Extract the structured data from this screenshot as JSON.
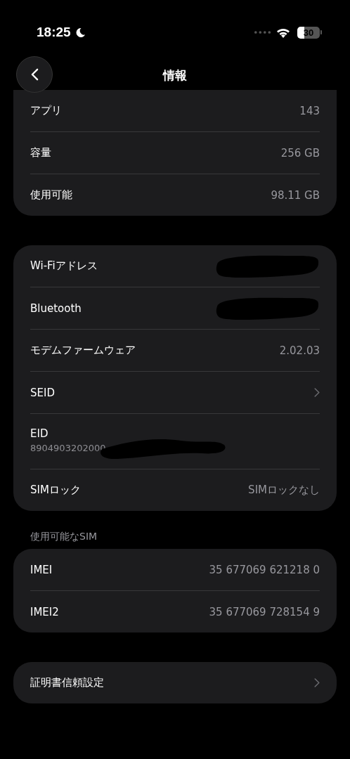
{
  "status_bar": {
    "time": "18:25",
    "focus_moon": true,
    "battery": "30"
  },
  "nav": {
    "title": "情報"
  },
  "sections": [
    {
      "rows": [
        {
          "kind": "value",
          "label": "アプリ",
          "value": "143"
        },
        {
          "kind": "value",
          "label": "容量",
          "value": "256 GB"
        },
        {
          "kind": "value",
          "label": "使用可能",
          "value": "98.11 GB"
        }
      ]
    },
    {
      "rows": [
        {
          "kind": "redacted",
          "label": "Wi-Fiアドレス"
        },
        {
          "kind": "redacted",
          "label": "Bluetooth"
        },
        {
          "kind": "value",
          "label": "モデムファームウェア",
          "value": "2.02.03"
        },
        {
          "kind": "chevron",
          "label": "SEID"
        },
        {
          "kind": "stacked",
          "label": "EID",
          "value": "8904903202000"
        },
        {
          "kind": "value",
          "label": "SIMロック",
          "value": "SIMロックなし"
        }
      ]
    },
    {
      "header": "使用可能なSIM",
      "rows": [
        {
          "kind": "value",
          "label": "IMEI",
          "value": "35 677069 621218 0"
        },
        {
          "kind": "value",
          "label": "IMEI2",
          "value": "35 677069 728154 9"
        }
      ]
    },
    {
      "rows": [
        {
          "kind": "chevron",
          "label": "証明書信頼設定"
        }
      ]
    }
  ]
}
